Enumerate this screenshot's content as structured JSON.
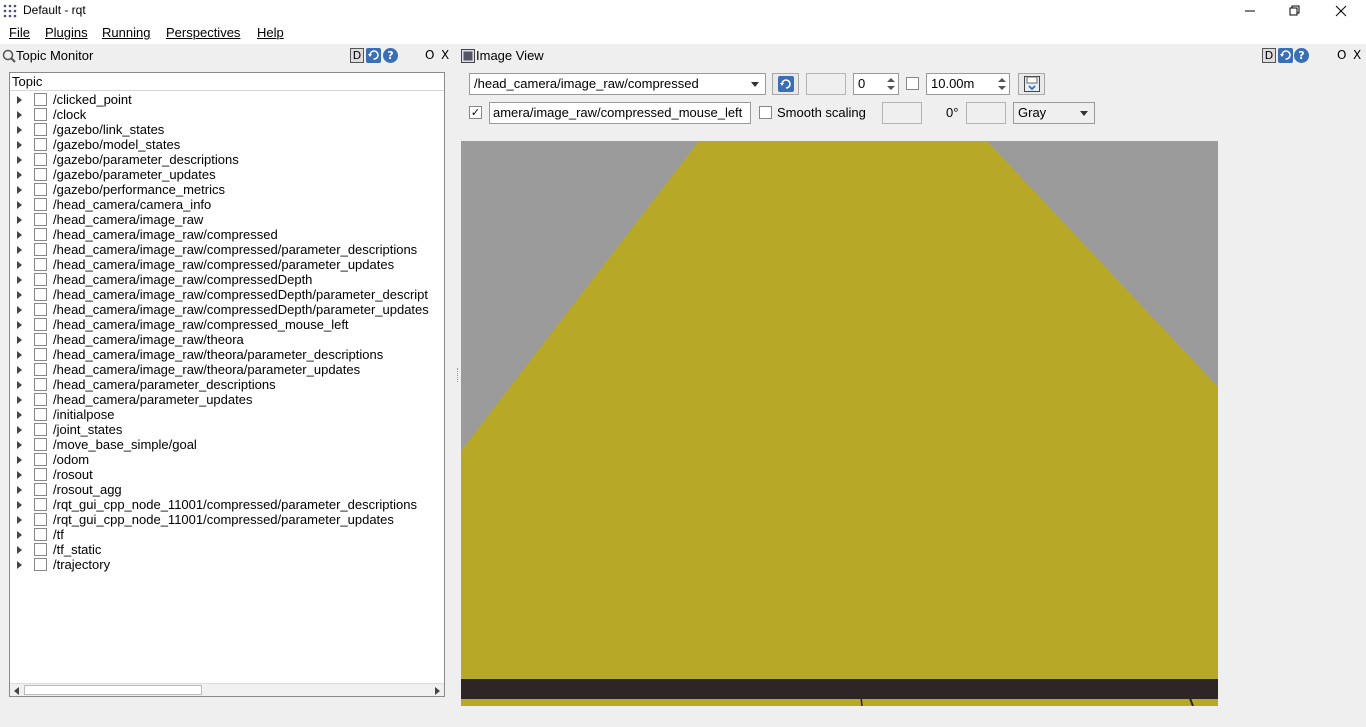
{
  "window": {
    "title": "Default - rqt",
    "controls": [
      "minimize",
      "restore",
      "close"
    ]
  },
  "menu": [
    "File",
    "Plugins",
    "Running",
    "Perspectives",
    "Help"
  ],
  "topic_monitor": {
    "title": "Topic Monitor",
    "dock_buttons": {
      "d": "D",
      "o": "O",
      "x": "X"
    },
    "column_header": "Topic",
    "topics": [
      "/clicked_point",
      "/clock",
      "/gazebo/link_states",
      "/gazebo/model_states",
      "/gazebo/parameter_descriptions",
      "/gazebo/parameter_updates",
      "/gazebo/performance_metrics",
      "/head_camera/camera_info",
      "/head_camera/image_raw",
      "/head_camera/image_raw/compressed",
      "/head_camera/image_raw/compressed/parameter_descriptions",
      "/head_camera/image_raw/compressed/parameter_updates",
      "/head_camera/image_raw/compressedDepth",
      "/head_camera/image_raw/compressedDepth/parameter_descript",
      "/head_camera/image_raw/compressedDepth/parameter_updates",
      "/head_camera/image_raw/compressed_mouse_left",
      "/head_camera/image_raw/theora",
      "/head_camera/image_raw/theora/parameter_descriptions",
      "/head_camera/image_raw/theora/parameter_updates",
      "/head_camera/parameter_descriptions",
      "/head_camera/parameter_updates",
      "/initialpose",
      "/joint_states",
      "/move_base_simple/goal",
      "/odom",
      "/rosout",
      "/rosout_agg",
      "/rqt_gui_cpp_node_11001/compressed/parameter_descriptions",
      "/rqt_gui_cpp_node_11001/compressed/parameter_updates",
      "/tf",
      "/tf_static",
      "/trajectory"
    ]
  },
  "image_view": {
    "title": "Image View",
    "dock_buttons": {
      "d": "D",
      "o": "O",
      "x": "X"
    },
    "topic_select": "/head_camera/image_raw/compressed",
    "spin_value": "0",
    "max_range": "10.00m",
    "publish_checked_mark": "✓",
    "mouse_topic": "amera/image_raw/compressed_mouse_left",
    "smooth_scaling_label": "Smooth scaling",
    "rotation": "0°",
    "color_scheme": "Gray",
    "colors": {
      "background": "#9b9b9b",
      "floor": "#b7a827",
      "bottom_edge": "#2e2626"
    }
  }
}
